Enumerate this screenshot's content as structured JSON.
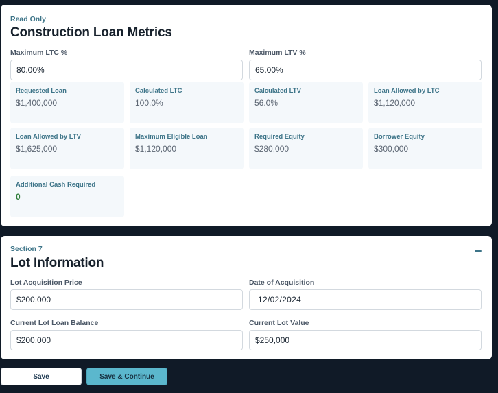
{
  "metrics_section": {
    "eyebrow": "Read Only",
    "title": "Construction Loan Metrics",
    "max_ltc_label": "Maximum LTC %",
    "max_ltc_value": "80.00%",
    "max_ltv_label": "Maximum LTV %",
    "max_ltv_value": "65.00%",
    "metrics": [
      {
        "label": "Requested Loan",
        "value": "$1,400,000"
      },
      {
        "label": "Calculated LTC",
        "value": "100.0%"
      },
      {
        "label": "Calculated LTV",
        "value": "56.0%"
      },
      {
        "label": "Loan Allowed by LTC",
        "value": "$1,120,000"
      },
      {
        "label": "Loan Allowed by LTV",
        "value": "$1,625,000"
      },
      {
        "label": "Maximum Eligible Loan",
        "value": "$1,120,000"
      },
      {
        "label": "Required Equity",
        "value": "$280,000"
      },
      {
        "label": "Borrower Equity",
        "value": "$300,000"
      },
      {
        "label": "Additional Cash Required",
        "value": "0"
      }
    ]
  },
  "lot_section": {
    "eyebrow": "Section 7",
    "title": "Lot Information",
    "collapse_icon": "minus-icon",
    "lot_price_label": "Lot Acquisition Price",
    "lot_price_value": "$200,000",
    "acq_date_label": "Date of Acquisition",
    "acq_date_value": "12/02/2024",
    "loan_balance_label": "Current Lot Loan Balance",
    "loan_balance_value": "$200,000",
    "lot_value_label": "Current Lot Value",
    "lot_value_value": "$250,000"
  },
  "actions": {
    "save_label": "Save",
    "save_continue_label": "Save & Continue"
  },
  "colors": {
    "background": "#101a27",
    "accent": "#3d7488",
    "primary_button": "#5bb7cd",
    "positive": "#2f7d3a"
  }
}
